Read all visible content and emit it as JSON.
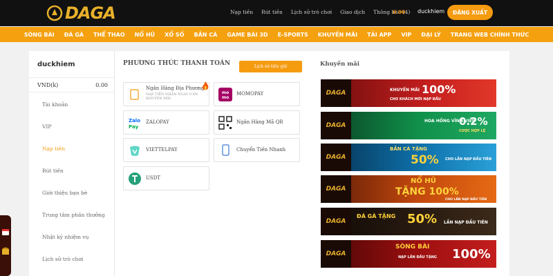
{
  "header": {
    "logo_text": "DAGA",
    "links": [
      "Nạp tiền",
      "Rút tiền",
      "Lịch sử trò chơi",
      "Giao dịch",
      "Thông báo (4)"
    ],
    "balance": "0.00",
    "username": "duckhiem",
    "logout_label": "ĐĂNG XUẤT"
  },
  "nav": {
    "items": [
      "SÒNG BÀI",
      "ĐÁ GÀ",
      "THỂ THAO",
      "NỔ HŨ",
      "XỔ SỐ",
      "BẮN CÁ",
      "GAME BÀI 3D",
      "E-SPORTS",
      "KHUYẾN MÃI",
      "TẢI APP",
      "VIP",
      "ĐẠI LÝ",
      "TRANG WEB CHÍNH THỨC"
    ]
  },
  "sidebar": {
    "username": "duckhiem",
    "currency": "VND(k)",
    "amount": "0.00",
    "items": [
      "Tài khoản",
      "VIP",
      "Nạp tiền",
      "Rút tiền",
      "Giới thiệu bạn bè",
      "Trung tâm phần thưởng",
      "Nhật ký nhiệm vụ",
      "Lịch sử trò chơi"
    ],
    "active_index": 2
  },
  "payment": {
    "title": "PHƯƠNG THỨC THANH TOÁN",
    "history_button": "Lịch sử tiền gửi",
    "methods": [
      {
        "label": "Ngân Hàng Địa Phương",
        "sub": "NẠP TIỀN NHẬN NGAY 0.8% KHUYẾN MÃI",
        "icon": "bank-card-icon"
      },
      {
        "label": "MOMOPAY",
        "icon": "momo-icon"
      },
      {
        "label": "ZALOPAY",
        "icon": "zalopay-icon"
      },
      {
        "label": "Ngân Hàng Mã QR",
        "icon": "qr-code-icon"
      },
      {
        "label": "VIETTELPAY",
        "icon": "viettelpay-icon"
      },
      {
        "label": "Chuyển Tiền Nhanh",
        "icon": "phone-icon"
      },
      {
        "label": "USDT",
        "icon": "usdt-icon"
      }
    ]
  },
  "promotions": {
    "title": "Khuyến mãi",
    "banners": [
      {
        "big": "100%",
        "line1": "KHUYẾN MÃI",
        "line2": "CHO KHÁCH MỚI NẠP ĐẦU",
        "color": "#b01818"
      },
      {
        "big": "0.2%",
        "line1": "HOA HỒNG VĨNH VIỄN",
        "line2": "CƯỢC HỢP LỆ",
        "color": "#0f7a3a"
      },
      {
        "big": "50%",
        "line1": "BẮN CÁ TẶNG",
        "line2": "CHO LẦN NẠP ĐẦU TIÊN",
        "color": "#0a5a8a"
      },
      {
        "big": "TẶNG 100%",
        "line1": "NỔ HŨ",
        "line2": "CHO LẦN NẠP ĐẦU TIÊN",
        "color": "#b5400c"
      },
      {
        "big": "50%",
        "line1": "ĐÁ GÀ TẶNG",
        "line2": "LẦN NẠP ĐẦU TIÊN",
        "color": "#1c1410"
      },
      {
        "big": "100%",
        "line1": "SÒNG BÀI",
        "line2": "NẠP LẦN ĐẦU TẶNG",
        "color": "#8a0c0c"
      }
    ]
  }
}
